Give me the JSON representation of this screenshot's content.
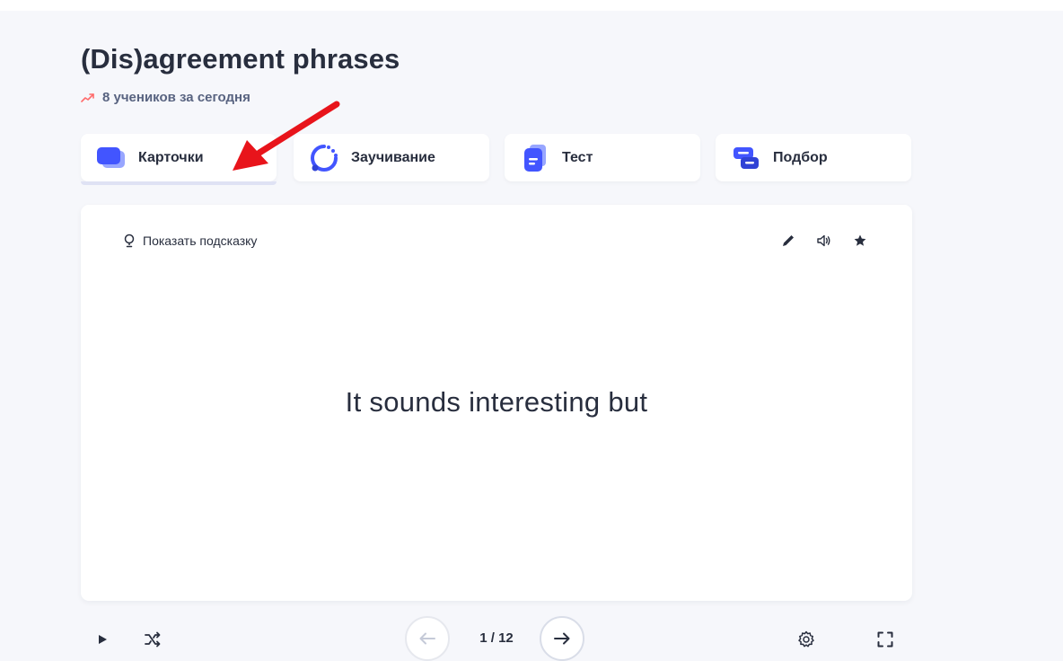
{
  "set": {
    "title": "(Dis)agreement phrases",
    "stats": "8 учеников за сегодня"
  },
  "modes": [
    {
      "label": "Карточки",
      "icon": "cards-icon",
      "active": true
    },
    {
      "label": "Заучивание",
      "icon": "learn-icon",
      "active": false
    },
    {
      "label": "Тест",
      "icon": "test-icon",
      "active": false
    },
    {
      "label": "Подбор",
      "icon": "match-icon",
      "active": false
    }
  ],
  "card": {
    "hint_label": "Показать подсказку",
    "term": "It sounds interesting but"
  },
  "controls": {
    "counter": "1 / 12"
  },
  "colors": {
    "primary": "#4255ff",
    "primary_dark": "#3042d6",
    "trend": "#ff6b6b",
    "annotation_arrow": "#e8141b",
    "text": "#282e3e",
    "muted": "#586380"
  }
}
